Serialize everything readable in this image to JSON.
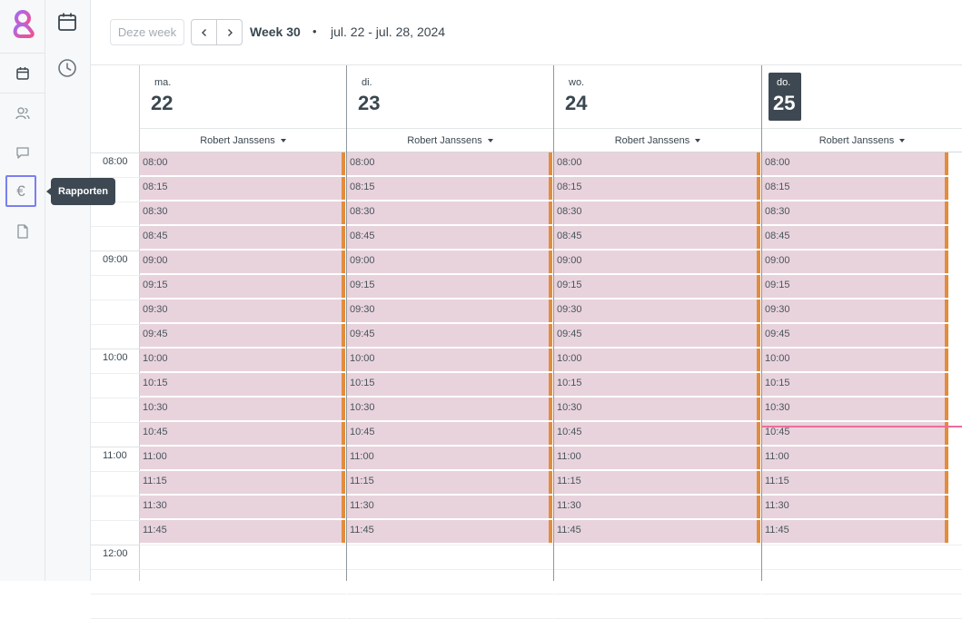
{
  "toolbar": {
    "this_week_label": "Deze week",
    "week_label": "Week 30",
    "separator": "•",
    "range_label": "jul. 22 - jul. 28, 2024"
  },
  "sidebar": {
    "tooltip": "Rapporten",
    "active_color": "#7b7ff0",
    "items": [
      {
        "icon": "calendar-icon"
      },
      {
        "icon": "users-icon"
      },
      {
        "icon": "chat-icon"
      },
      {
        "icon": "euro-icon",
        "glyph": "€"
      },
      {
        "icon": "document-icon"
      }
    ]
  },
  "subnav": {
    "items": [
      {
        "icon": "calendar-icon"
      },
      {
        "icon": "clock-icon"
      }
    ]
  },
  "time_labels": [
    "08:00",
    "09:00",
    "10:00",
    "11:00",
    "12:00"
  ],
  "days": [
    {
      "abbr": "ma.",
      "num": "22",
      "resource": "Robert Janssens",
      "today": false
    },
    {
      "abbr": "di.",
      "num": "23",
      "resource": "Robert Janssens",
      "today": false
    },
    {
      "abbr": "wo.",
      "num": "24",
      "resource": "Robert Janssens",
      "today": false
    },
    {
      "abbr": "do.",
      "num": "25",
      "resource": "Robert Janssens",
      "today": true
    }
  ],
  "slots": [
    "08:00",
    "08:15",
    "08:30",
    "08:45",
    "09:00",
    "09:15",
    "09:30",
    "09:45",
    "10:00",
    "10:15",
    "10:30",
    "10:45",
    "11:00",
    "11:15",
    "11:30",
    "11:45"
  ],
  "colors": {
    "slot_bg": "#e8d3dc",
    "slot_bar": "#e38c3c",
    "now_line": "#ef6b9a",
    "today_bg": "#3d4852"
  }
}
